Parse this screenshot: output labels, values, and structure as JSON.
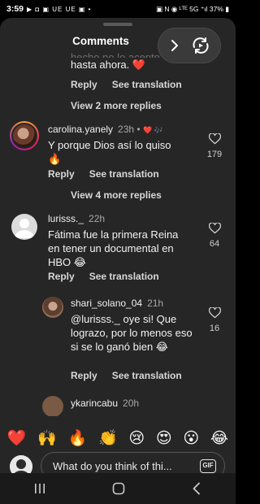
{
  "status": {
    "time": "3:59",
    "notifications": "▶ ◘ ▣ UE UE ▣ •",
    "right": "▣ N ◉ ᴸᵀᴱ 5G ⁺ıl 37% ▮"
  },
  "sheet": {
    "title": "Comments"
  },
  "clipped_comment": {
    "line1": "hecho no lo acepto",
    "line2": "hasta ahora. ❤️",
    "reply": "Reply",
    "see_translation": "See translation"
  },
  "view_replies_1": "View 2 more replies",
  "comments": [
    {
      "username": "carolina.yanely",
      "time": "23h •",
      "badges": "❤️ 🎶",
      "text": "Y porque Dios así lo quiso 🔥",
      "likes": "179",
      "reply": "Reply",
      "see_translation": "See translation"
    },
    {
      "username": "lurisss._",
      "time": "22h",
      "text": "Fátima fue la primera Reina en tener un documental en HBO 😂",
      "likes": "64",
      "reply": "Reply",
      "see_translation": "See translation"
    },
    {
      "username": "shari_solano_04",
      "time": "21h",
      "text": "@lurisss._ oye si! Que lograzo, por lo menos eso si se lo ganó bien 😂",
      "likes": "16",
      "reply": "Reply",
      "see_translation": "See translation"
    },
    {
      "username": "ykarincabu",
      "time": "20h"
    }
  ],
  "view_replies_2": "View 4 more replies",
  "emoji_bar": [
    "❤️",
    "🙌",
    "🔥",
    "👏",
    "😢",
    "😍",
    "😮",
    "😂"
  ],
  "input": {
    "placeholder": "What do you think of thi...",
    "gif_label": "GIF"
  },
  "icons": {
    "pill": [
      "chevron-right-icon",
      "reel-repost-icon"
    ],
    "nav": [
      "recents-icon",
      "home-icon",
      "back-icon"
    ]
  }
}
